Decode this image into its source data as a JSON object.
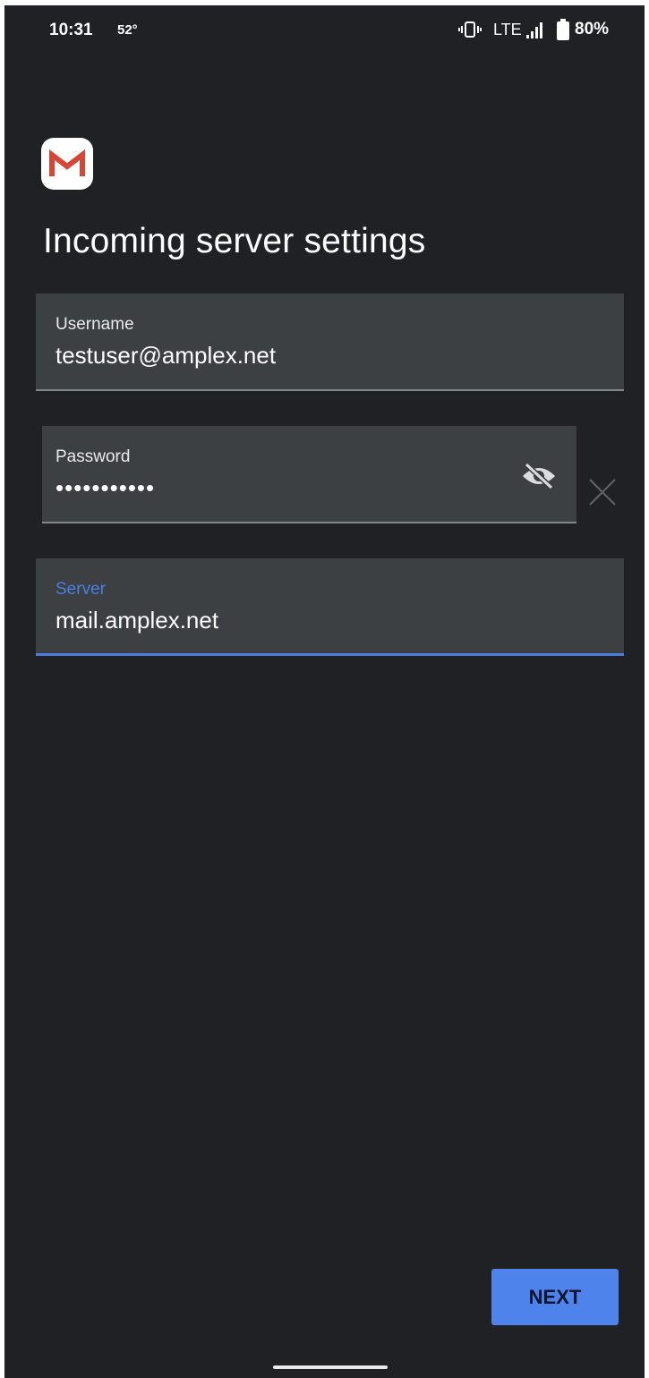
{
  "status_bar": {
    "time": "10:31",
    "temperature": "52°",
    "network": "LTE",
    "battery": "80%",
    "icons": [
      "vibrate-icon",
      "signal-icon",
      "battery-icon"
    ]
  },
  "app": {
    "logo": "gmail-logo",
    "title": "Incoming server settings"
  },
  "form": {
    "username": {
      "label": "Username",
      "value": "testuser@amplex.net"
    },
    "password": {
      "label": "Password",
      "value": "•••••••••••"
    },
    "server": {
      "label": "Server",
      "value": "mail.amplex.net"
    }
  },
  "actions": {
    "next_label": "NEXT"
  },
  "colors": {
    "background": "#202124",
    "field_background": "#3c4043",
    "accent": "#4a7ee0",
    "button": "#4f83ec",
    "gmail_red": "#d44638"
  }
}
